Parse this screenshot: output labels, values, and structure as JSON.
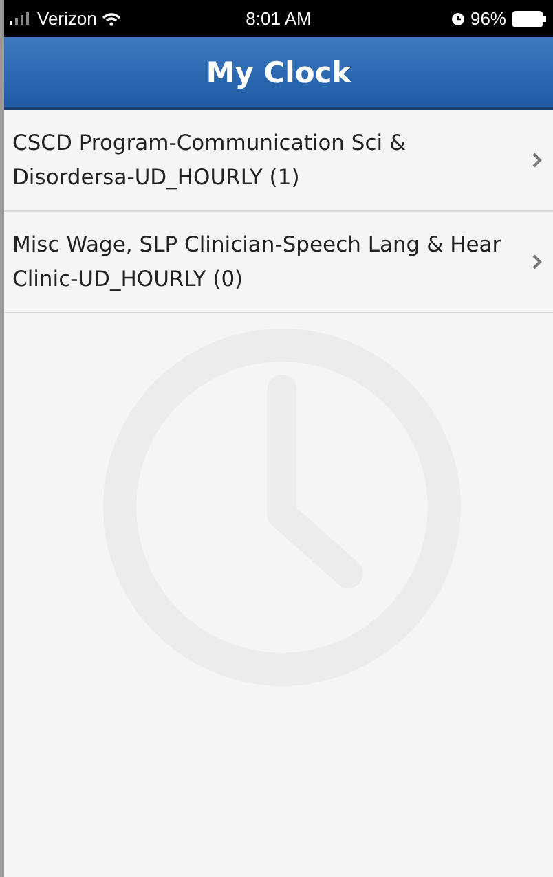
{
  "status_bar": {
    "carrier": "Verizon",
    "time": "8:01 AM",
    "battery": "96%"
  },
  "header": {
    "title": "My Clock"
  },
  "items": [
    {
      "label": "CSCD Program-Communication Sci & Disordersa-UD_HOURLY (1)"
    },
    {
      "label": "Misc Wage, SLP Clinician-Speech Lang & Hear Clinic-UD_HOURLY (0)"
    }
  ]
}
